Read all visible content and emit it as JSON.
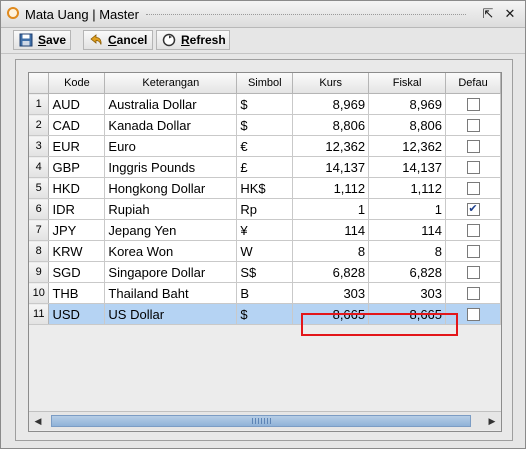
{
  "window": {
    "title": "Mata Uang | Master",
    "restore_glyph": "⇱",
    "close_glyph": "✕"
  },
  "toolbar": {
    "save": "ave",
    "save_key": "S",
    "cancel": "ancel",
    "cancel_key": "C",
    "refresh": "efresh",
    "refresh_key": "R"
  },
  "grid": {
    "columns": [
      "",
      "Kode",
      "Keterangan",
      "Simbol",
      "Kurs",
      "Fiskal",
      "Defau"
    ],
    "rows": [
      {
        "no": "1",
        "kode": "AUD",
        "ket": "Australia Dollar",
        "sim": "$",
        "kurs": "8,969",
        "fis": "8,969",
        "def": false
      },
      {
        "no": "2",
        "kode": "CAD",
        "ket": "Kanada Dollar",
        "sim": "$",
        "kurs": "8,806",
        "fis": "8,806",
        "def": false
      },
      {
        "no": "3",
        "kode": "EUR",
        "ket": "Euro",
        "sim": "€",
        "kurs": "12,362",
        "fis": "12,362",
        "def": false
      },
      {
        "no": "4",
        "kode": "GBP",
        "ket": "Inggris Pounds",
        "sim": "£",
        "kurs": "14,137",
        "fis": "14,137",
        "def": false
      },
      {
        "no": "5",
        "kode": "HKD",
        "ket": "Hongkong Dollar",
        "sim": "HK$",
        "kurs": "1,112",
        "fis": "1,112",
        "def": false
      },
      {
        "no": "6",
        "kode": "IDR",
        "ket": "Rupiah",
        "sim": "Rp",
        "kurs": "1",
        "fis": "1",
        "def": true
      },
      {
        "no": "7",
        "kode": "JPY",
        "ket": "Jepang Yen",
        "sim": "¥",
        "kurs": "114",
        "fis": "114",
        "def": false
      },
      {
        "no": "8",
        "kode": "KRW",
        "ket": "Korea Won",
        "sim": "W",
        "kurs": "8",
        "fis": "8",
        "def": false
      },
      {
        "no": "9",
        "kode": "SGD",
        "ket": "Singapore Dollar",
        "sim": "S$",
        "kurs": "6,828",
        "fis": "6,828",
        "def": false
      },
      {
        "no": "10",
        "kode": "THB",
        "ket": "Thailand Baht",
        "sim": "B",
        "kurs": "303",
        "fis": "303",
        "def": false
      },
      {
        "no": "11",
        "kode": "USD",
        "ket": "US Dollar",
        "sim": "$",
        "kurs": "8,665",
        "fis": "8,665",
        "def": false
      }
    ],
    "selected_row": "11",
    "check_glyph": "✔"
  },
  "colors": {
    "selection": "#b5d3f3",
    "highlight": "#e3161a",
    "scroll_thumb": "#8fb2d8"
  }
}
